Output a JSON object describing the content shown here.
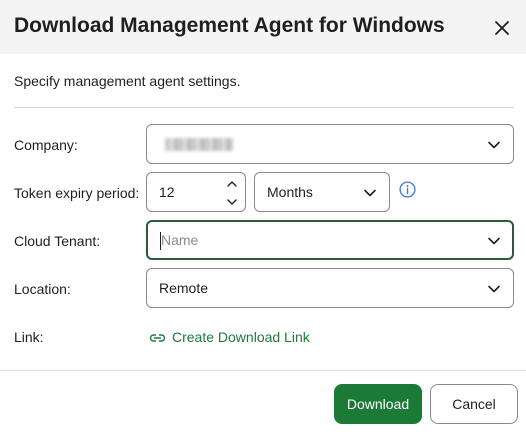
{
  "dialog": {
    "title": "Download Management Agent for Windows",
    "subtitle": "Specify management agent settings."
  },
  "form": {
    "company": {
      "label": "Company:",
      "value": ""
    },
    "token_expiry": {
      "label": "Token expiry period:",
      "value": "12",
      "unit": "Months"
    },
    "cloud_tenant": {
      "label": "Cloud Tenant:",
      "placeholder": "Name"
    },
    "location": {
      "label": "Location:",
      "value": "Remote"
    },
    "link": {
      "label": "Link:",
      "text": "Create Download Link"
    }
  },
  "footer": {
    "download_label": "Download",
    "cancel_label": "Cancel"
  },
  "colors": {
    "accent": "#1a7a36",
    "link": "#1e7a3c",
    "focus_border": "#2e5a3c",
    "info": "#3a7bd5"
  },
  "icons": [
    "close-icon",
    "chevron-down-icon",
    "stepper-up-icon",
    "stepper-down-icon",
    "info-icon",
    "link-icon"
  ]
}
